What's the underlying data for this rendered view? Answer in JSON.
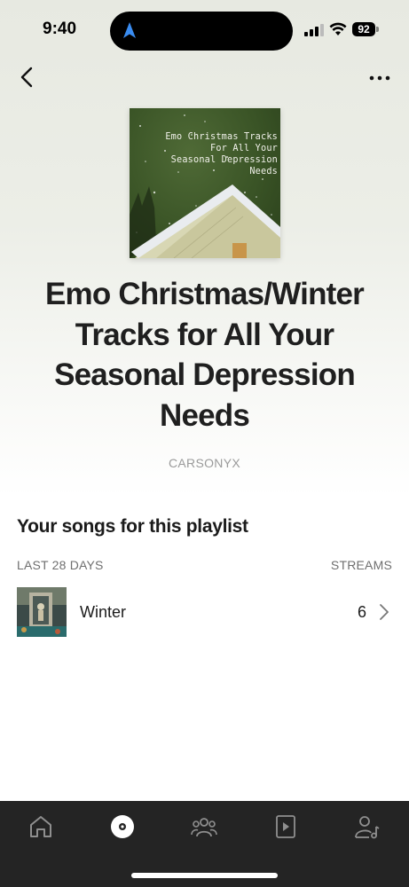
{
  "status_bar": {
    "time": "9:40",
    "battery": "92"
  },
  "header": {
    "back_icon": "chevron-left-icon",
    "more_icon": "ellipsis-icon"
  },
  "playlist": {
    "cover_text": "Emo Christmas Tracks\nFor All Your\nSeasonal Depression\nNeeds",
    "title": "Emo Christmas/Winter Tracks for All Your Seasonal Depression Needs",
    "owner": "CARSONYX"
  },
  "songs_section": {
    "heading": "Your songs for this playlist",
    "period_label": "LAST 28 DAYS",
    "streams_label": "STREAMS",
    "songs": [
      {
        "title": "Winter",
        "streams": "6"
      }
    ]
  },
  "tab_bar": {
    "tabs": [
      "home-icon",
      "music-disc-icon",
      "audience-icon",
      "video-icon",
      "artist-profile-icon"
    ],
    "active_tab": "music-disc-icon",
    "background": "#242424",
    "icon_color": "#8f8f8f"
  }
}
